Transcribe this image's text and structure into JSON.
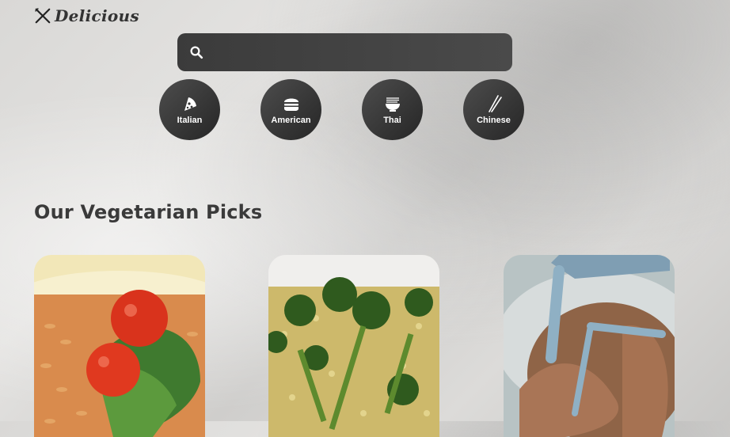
{
  "brand": {
    "name": "Delicious"
  },
  "search": {
    "placeholder": "",
    "value": ""
  },
  "cuisines": [
    {
      "label": "Italian",
      "icon": "pizza-icon"
    },
    {
      "label": "American",
      "icon": "burger-icon"
    },
    {
      "label": "Thai",
      "icon": "noodle-bowl-icon"
    },
    {
      "label": "Chinese",
      "icon": "chopsticks-icon"
    }
  ],
  "section": {
    "title": "Our Vegetarian Picks"
  },
  "cards": [
    {
      "icon": "tomato-rice-dish-image"
    },
    {
      "icon": "broccoli-couscous-dish-image"
    },
    {
      "icon": "chocolate-mixer-image"
    }
  ],
  "colors": {
    "dark": "#333333",
    "background": "#d9d8d6",
    "text": "#3a3a3a"
  }
}
